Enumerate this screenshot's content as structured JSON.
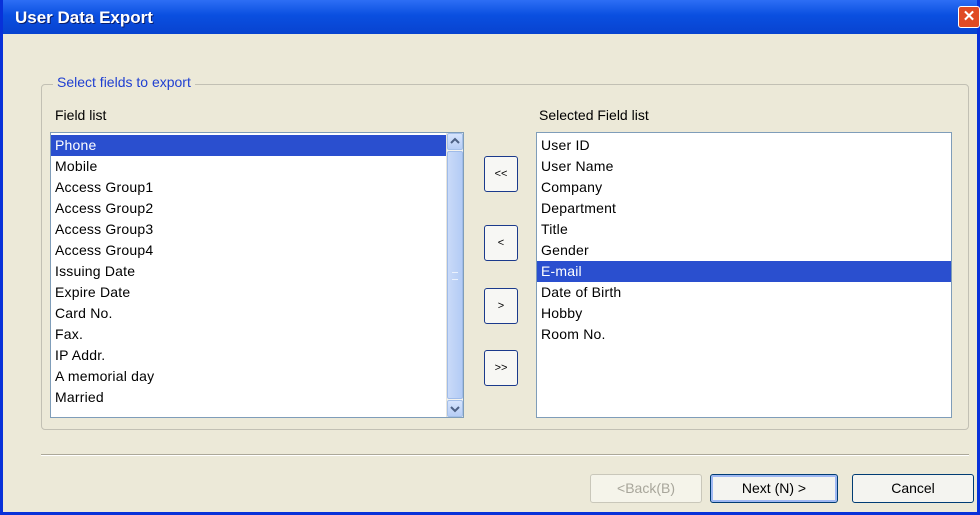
{
  "window": {
    "title": "User Data Export",
    "close_icon": "close-icon"
  },
  "group": {
    "legend": "Select fields to export"
  },
  "field_list": {
    "label": "Field list",
    "items": [
      "Phone",
      "Mobile",
      "Access Group1",
      "Access Group2",
      "Access Group3",
      "Access Group4",
      "Issuing Date",
      "Expire Date",
      "Card No.",
      "Fax.",
      "IP Addr.",
      "A memorial day",
      "Married"
    ],
    "selected": "Phone"
  },
  "selected_list": {
    "label": "Selected Field list",
    "items": [
      "User ID",
      "User Name",
      "Company",
      "Department",
      "Title",
      "Gender",
      "E-mail",
      "Date of Birth",
      "Hobby",
      "Room No."
    ],
    "selected": "E-mail"
  },
  "move_buttons": {
    "remove_all": "<<",
    "remove": "<",
    "add": ">",
    "add_all": ">>"
  },
  "footer": {
    "back_label": "<Back(B)",
    "next_label": "Next (N) >",
    "cancel_label": "Cancel"
  },
  "colors": {
    "titlebar": "#0a4fe0",
    "selection": "#2a4fcf",
    "legend_text": "#1f3fd1"
  }
}
